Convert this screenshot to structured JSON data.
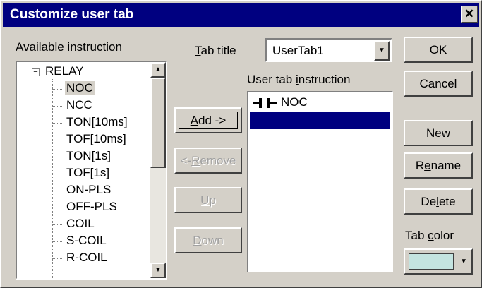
{
  "dialog": {
    "title": "Customize user tab",
    "close_glyph": "✕"
  },
  "available": {
    "label_pre": "A",
    "label_accel": "v",
    "label_post": "ailable instruction",
    "root": {
      "expander": "−",
      "label": "RELAY"
    },
    "items": [
      "NOC",
      "NCC",
      "TON[10ms]",
      "TOF[10ms]",
      "TON[1s]",
      "TOF[1s]",
      "ON-PLS",
      "OFF-PLS",
      "COIL",
      "S-COIL",
      "R-COIL"
    ],
    "selected_item": "NOC"
  },
  "tab_title": {
    "label_accel": "T",
    "label_post": "ab title",
    "value": "UserTab1"
  },
  "user_tab": {
    "label_pre": "User tab ",
    "label_accel": "i",
    "label_post": "nstruction",
    "items": [
      {
        "icon": "contact-no-icon",
        "label": "NOC"
      }
    ]
  },
  "buttons": {
    "add_accel": "A",
    "add_post": "dd ->",
    "remove_pre": "<-",
    "remove_accel": "R",
    "remove_post": "emove",
    "up_accel": "U",
    "up_post": "p",
    "down_accel": "D",
    "down_post": "own",
    "ok": "OK",
    "cancel": "Cancel",
    "new_accel": "N",
    "new_post": "ew",
    "rename_pre": "R",
    "rename_accel": "e",
    "rename_post": "name",
    "delete_pre": "De",
    "delete_accel": "l",
    "delete_post": "ete"
  },
  "tab_color": {
    "label_pre": "Tab ",
    "label_accel": "c",
    "label_post": "olor",
    "color": "#c4e4e0"
  },
  "colors": {
    "title_bar": "#000080",
    "selection": "#000080",
    "face": "#d4d0c8"
  }
}
